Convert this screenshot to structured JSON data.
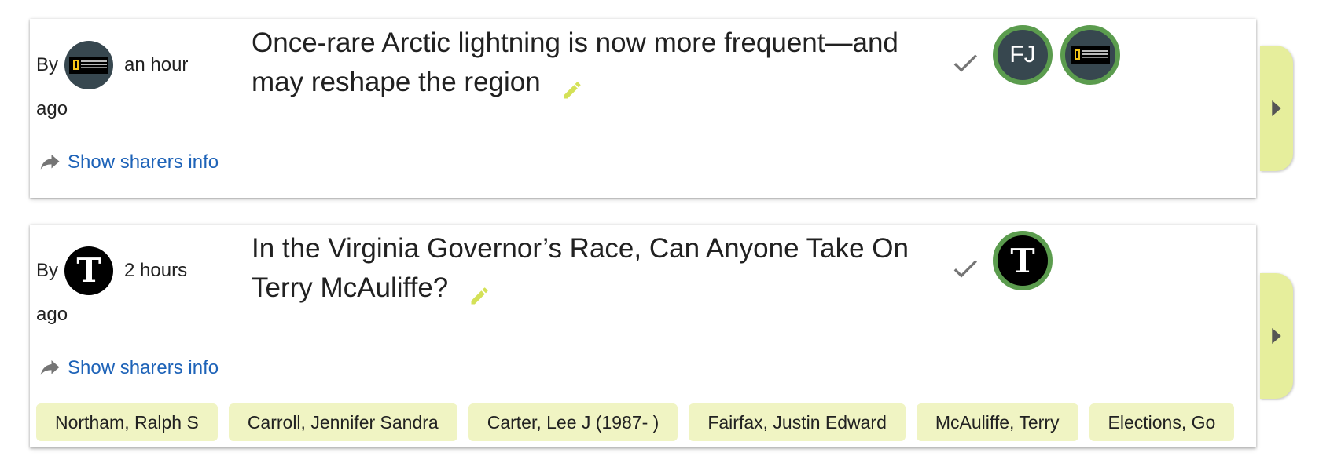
{
  "articles": [
    {
      "by_label": "By",
      "source_icon": "national-geographic-logo",
      "time": "an hour",
      "time_suffix": "ago",
      "title": "Once-rare Arctic lightning is now more frequent—and may reshape the region",
      "show_sharers_label": "Show sharers info",
      "sharers": [
        {
          "type": "initials",
          "initials": "FJ"
        },
        {
          "type": "logo",
          "icon": "national-geographic-logo"
        }
      ],
      "tags": []
    },
    {
      "by_label": "By",
      "source_icon": "new-york-times-logo",
      "nyt_glyph": "T",
      "time": "2 hours",
      "time_suffix": "ago",
      "title": "In the Virginia Governor’s Race, Can Anyone Take On Terry McAuliffe?",
      "show_sharers_label": "Show sharers info",
      "sharers": [
        {
          "type": "logo",
          "icon": "new-york-times-logo"
        }
      ],
      "tags": [
        "Northam, Ralph S",
        "Carroll, Jennifer Sandra",
        "Carter, Lee J (1987- )",
        "Fairfax, Justin Edward",
        "McAuliffe, Terry",
        "Elections, Go"
      ]
    }
  ],
  "colors": {
    "link": "#1e63b8",
    "edit_icon": "#d4e157",
    "check_icon": "#757575",
    "sharer_ring": "#5b9c4e",
    "tag_bg": "#f0f4c3",
    "side_tab": "#e6ee9c"
  }
}
